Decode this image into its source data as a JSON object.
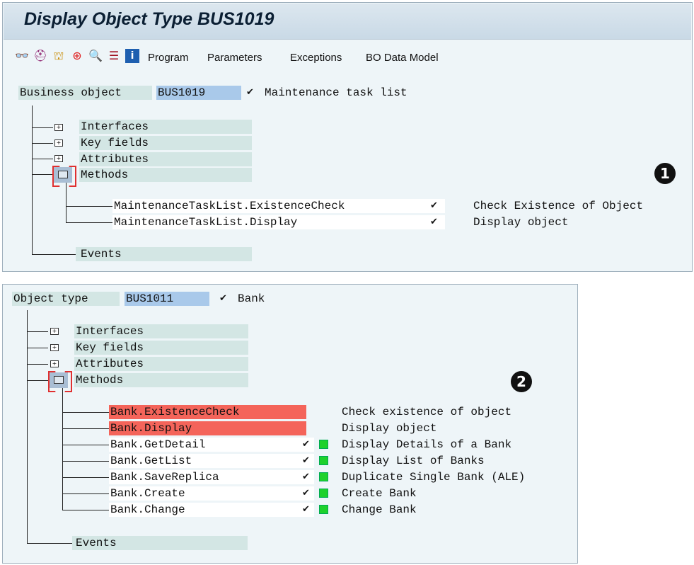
{
  "window": {
    "title": "Display Object Type BUS1019"
  },
  "toolbar": {
    "icons": [
      "glasses-icon",
      "hat-icon",
      "hierarchy-icon",
      "lifebuoy-icon",
      "search-icon",
      "list-icon",
      "info-icon"
    ],
    "menu": [
      "Program",
      "Parameters",
      "Exceptions",
      "BO Data Model"
    ]
  },
  "panel1": {
    "field_label": "Business object",
    "key": "BUS1019",
    "check": "✔",
    "description": "Maintenance task list",
    "nodes": [
      "Interfaces",
      "Key fields",
      "Attributes",
      "Methods"
    ],
    "methods": [
      {
        "name": "MaintenanceTaskList.ExistenceCheck",
        "check": "✔",
        "desc": "Check Existence of Object"
      },
      {
        "name": "MaintenanceTaskList.Display",
        "check": "✔",
        "desc": "Display object"
      }
    ],
    "events": "Events",
    "badge": "1"
  },
  "panel2": {
    "field_label": "Object type",
    "key": "BUS1011",
    "check": "✔",
    "description": "Bank",
    "nodes": [
      "Interfaces",
      "Key fields",
      "Attributes",
      "Methods"
    ],
    "methods": [
      {
        "name": "Bank.ExistenceCheck",
        "check": "",
        "desc": "Check existence of object",
        "highlight": true
      },
      {
        "name": "Bank.Display",
        "check": "",
        "desc": "Display object",
        "highlight": true
      },
      {
        "name": "Bank.GetDetail",
        "check": "✔",
        "desc": "Display Details of a Bank",
        "status": "green"
      },
      {
        "name": "Bank.GetList",
        "check": "✔",
        "desc": "Display List of Banks",
        "status": "green"
      },
      {
        "name": "Bank.SaveReplica",
        "check": "✔",
        "desc": "Duplicate Single Bank (ALE)",
        "status": "green"
      },
      {
        "name": "Bank.Create",
        "check": "✔",
        "desc": "Create Bank",
        "status": "green"
      },
      {
        "name": "Bank.Change",
        "check": "✔",
        "desc": "Change Bank",
        "status": "green"
      }
    ],
    "events": "Events",
    "badge": "2"
  },
  "colors": {
    "highlight": "#f4645a",
    "key_bg": "#a9c9ea",
    "node_bg": "#d3e6e4",
    "status_green": "#1fd12c"
  }
}
